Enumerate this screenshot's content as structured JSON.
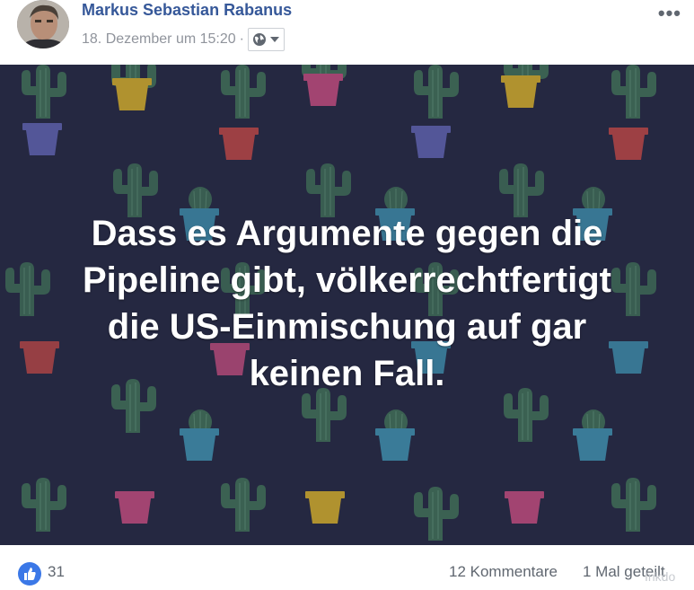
{
  "post": {
    "author": "Markus Sebastian Rabanus",
    "timestamp": "18. Dezember um 15:20",
    "separator": "·",
    "audience_icon": "globe-icon",
    "more_label": "•••",
    "image_text": [
      "Dass es Argumente gegen die",
      "Pipeline gibt, völkerrechtfertigt",
      "die US-Einmischung auf gar",
      "keinen Fall."
    ],
    "image_background": "#252841",
    "text_color": "#ffffff"
  },
  "footer": {
    "reaction_icon": "thumbs-up-icon",
    "like_count": "31",
    "comments": "12 Kommentare",
    "shares": "1 Mal geteilt",
    "watermark": "Inkdo"
  },
  "colors": {
    "author": "#365899",
    "meta": "#90949c",
    "like_blue": "#3b78e7",
    "cactus_green": "#3f6b56",
    "pot_colors": [
      "#c9a52c",
      "#5c5fa8",
      "#b84a7a",
      "#b34545",
      "#3e8aa8"
    ]
  }
}
